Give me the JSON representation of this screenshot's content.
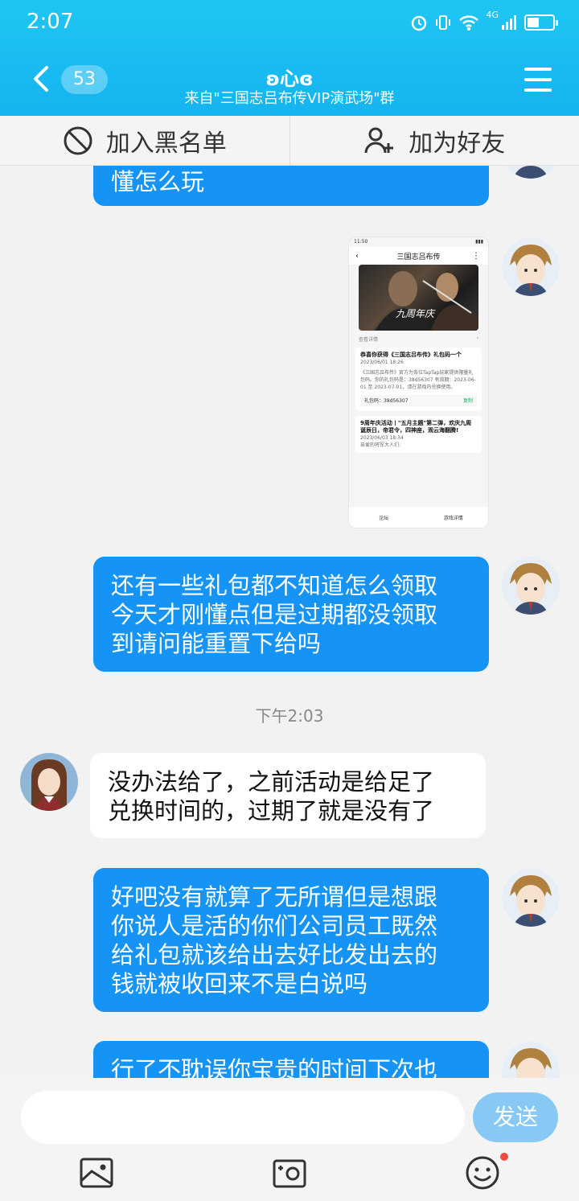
{
  "status_bar": {
    "time": "2:07",
    "network": "4G"
  },
  "header": {
    "back_count": "53",
    "title": "ʚ心ɞ",
    "subtitle": "来自\"三国志吕布传VIP演武场\"群"
  },
  "actions": {
    "blacklist": "加入黑名单",
    "add_friend": "加为好友"
  },
  "messages": [
    {
      "side": "me",
      "text": "懂怎么玩"
    },
    {
      "side": "me",
      "type": "image"
    },
    {
      "side": "me",
      "lines": [
        "还有一些礼包都不知道怎么领取",
        "今天才刚懂点但是过期都没领取",
        "到请问能重置下给吗"
      ]
    },
    {
      "side": "them",
      "lines": [
        "没办法给了，之前活动是给足了",
        "兑换时间的，过期了就是没有了"
      ]
    },
    {
      "side": "me",
      "lines": [
        "好吧没有就算了无所谓但是想跟",
        "你说人是活的你们公司员工既然",
        "给礼包就该给出去好比发出去的",
        "钱就被收回来不是白说吗"
      ]
    },
    {
      "side": "me",
      "text": "行了不耽误你宝贵的时间下次也"
    }
  ],
  "timestamp": "下午2:03",
  "shared_screenshot": {
    "time": "11:50",
    "title": "三国志吕布传",
    "banner_text": "九周年庆",
    "link": "查看详情",
    "card1_title": "恭喜你获得《三国志吕布传》礼包码一个",
    "card1_date": "2023/06/01 18:26",
    "card1_body": "《三国志吕布传》官方为各位TapTap玩家提供限量礼包码。你的礼包码是：38d56307 有效期：2023-06-01 至 2023-07-01，请在游戏内兑换使用。",
    "code_label": "礼包码：38d56307",
    "copy_label": "复制",
    "card2_title": "9周年庆活动丨\"五月主题\"第二弹，欢庆九周诞辰日，帝君令，四神座，观云海翻腾!",
    "card2_date": "2023/06/03 18:34",
    "card2_body": "亲爱的将军大人们:",
    "foot_forum": "论坛",
    "foot_detail": "游戏详情"
  },
  "input": {
    "send_label": "发送"
  },
  "colors": {
    "header": "#14b4f0",
    "my_bubble": "#1594f6",
    "their_bubble": "#ffffff",
    "send": "#87c8f5"
  }
}
